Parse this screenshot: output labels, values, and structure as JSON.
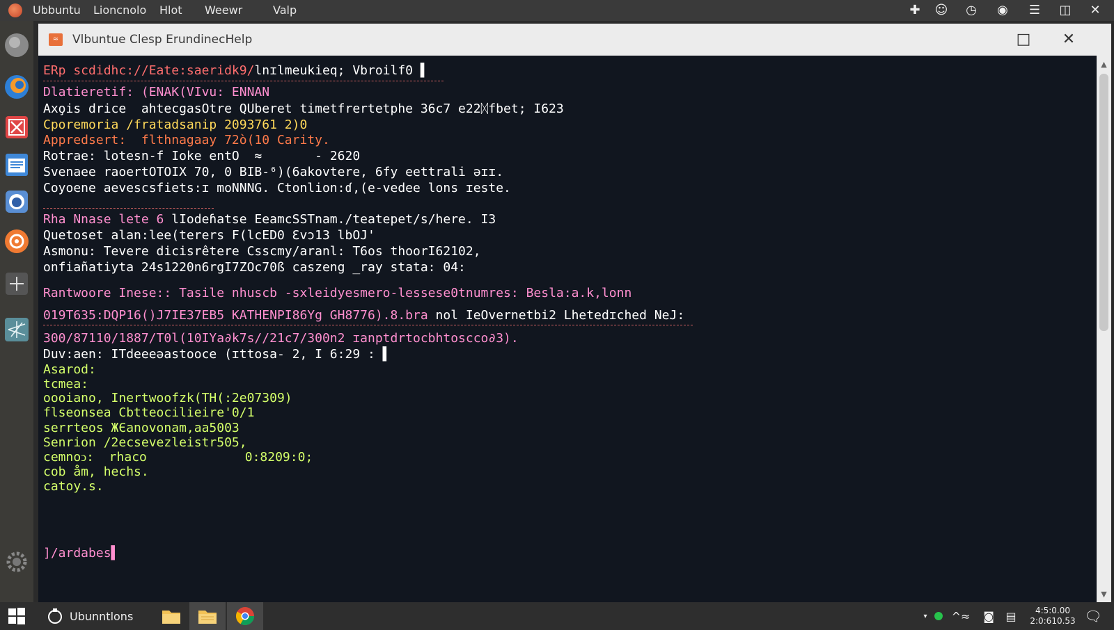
{
  "topbar": {
    "menus": [
      "Ubbuntu",
      "Lioncnolo",
      "Hlot",
      "Weewr",
      "Valp"
    ]
  },
  "window": {
    "title": "Vlbuntue Clesp ErundinecHelp",
    "maximize_icon": "maximize-icon",
    "close_icon": "close-icon"
  },
  "terminal": {
    "lines": [
      {
        "text": "ERp scdidhc://Eate:saeridk9/",
        "text2": "lnɪlmeukieq; Vbroilf0 ▌",
        "color": "#ff6e6e",
        "color2": "#ffffff"
      },
      {
        "text": "Dlatieretif: (ENAK(VIvu: ENNAN",
        "color": "#ff8fcf"
      },
      {
        "text": "Axo̧is drice  ahtecgasOtre QUberet timetfrertetphe 36c7 e22ᛞfbet; I623",
        "color": "#ffffff"
      },
      {
        "text": "Cporemoria /fratadsanip 2093761 2)0",
        "color": "#ffd95a"
      },
      {
        "text": "Appredsert:  flthnagaay 72ò(10 Carity.",
        "color": "#ff7a4a"
      },
      {
        "text": "Rotrae: lotesn-f Ioke entO  ≈       - 2620",
        "color": "#ffffff"
      },
      {
        "text": "Svenaee raoertOTOIX 70, 0 BIB-⁶)(6akovtere, 6fy eettrali ǝɪɪ.",
        "color": "#ffffff"
      },
      {
        "text": "Coyoene aevescsfiets:ɪ moNNNG. Ctonlion:ɗ,(e-vedee lons ɪeste.",
        "color": "#ffffff"
      },
      {
        "text": "Rha Nnase lete 6 ",
        "text2": "lIodeɦatse EeamcSSTnam./teatepet/s/here. I3",
        "color": "#ff8fcf",
        "color2": "#ffffff"
      },
      {
        "text": "Quetoset alan:lee(terers F(lcED0 Ɛvɔ13 lbOJ'",
        "color": "#ffffff"
      },
      {
        "text": "Asmonu: Tevere dicisrêtere Csscmy/aranl: T6os thoorI62102,",
        "color": "#ffffff"
      },
      {
        "text": "onfiañatiyta 24s1220n6rgI7ZOc70ß caszeng _ray stata: 04:",
        "color": "#ffffff"
      },
      {
        "text": "Rantwoore Inese:: Tasile nhuscb -sxleidyesmero-lessese0tnumres: Besla:a.k,lonn",
        "color": "#ff8fcf"
      },
      {
        "text": "019T635:DQP16()J7IE37EB5 KATHENPI86Yg GH8776).8.bra ",
        "text2": "nol IeOvernetbi2 Lhetedɪched NeJ:",
        "color": "#ff8fcf",
        "color2": "#ffffff"
      },
      {
        "text": "300/87110/1887/T0l(10IYa∂k7s//21c7/300n2 ɪanptdrtocbhtoscco∂3).",
        "color": "#ff8fcf"
      },
      {
        "text": "Duv:aen: ITdeeeəastooce (ɪttosa- 2, I 6:29 : ▌",
        "color": "#ffffff"
      },
      {
        "text": "Asarod:",
        "color": "#d4ff6a"
      },
      {
        "text": "tcmea:",
        "color": "#d4ff6a"
      },
      {
        "text": "oooiano, Inertwoofzk(TH(:2e07309)",
        "color": "#d4ff6a"
      },
      {
        "text": "flseonsea Cbtteocilieire'0/1",
        "color": "#d4ff6a"
      },
      {
        "text": "serrteos ЖЄanovonam,aa5003",
        "color": "#d4ff6a"
      },
      {
        "text": "Senrion /2ecsevezleistr505,",
        "color": "#d4ff6a"
      },
      {
        "text": "cemnoↄ:  rhaco             0:8209:0;",
        "color": "#d4ff6a"
      },
      {
        "text": "cob åm, hechs.",
        "color": "#d4ff6a"
      },
      {
        "text": "catoy.s.",
        "color": "#d4ff6a"
      },
      {
        "text": "]/ardabes▌",
        "color": "#ff8fcf"
      }
    ]
  },
  "taskbar": {
    "start_icon": "windows-start-icon",
    "search_label": "Ubunntlons",
    "clock_time": "4:5:0.00",
    "clock_date": "2:0:610.53"
  }
}
